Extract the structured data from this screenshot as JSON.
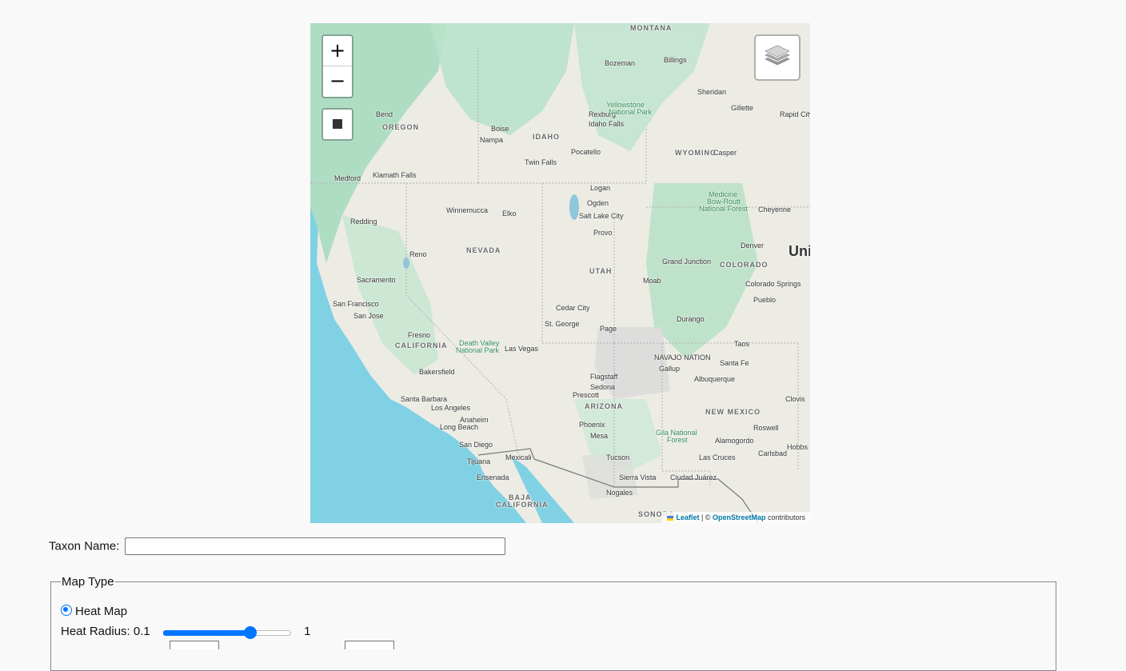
{
  "map": {
    "zoom_in_label": "+",
    "zoom_out_label": "−",
    "attribution": {
      "leaflet": "Leaflet",
      "separator": " | © ",
      "osm": "OpenStreetMap",
      "suffix": " contributors"
    },
    "labels": {
      "montana": "MONTANA",
      "idaho": "IDAHO",
      "oregon": "OREGON",
      "wyoming": "WYOMING",
      "nevada": "NEVADA",
      "utah": "UTAH",
      "colorado": "COLORADO",
      "california": "CALIFORNIA",
      "arizona": "ARIZONA",
      "new_mexico": "NEW MEXICO",
      "sonora": "SONORA",
      "baja1": "BAJA",
      "baja2": "CALIFORNIA",
      "uni": "Uni",
      "sacramento": "Sacramento",
      "san_francisco": "San Francisco",
      "san_jose": "San Jose",
      "fresno": "Fresno",
      "bakersfield": "Bakersfield",
      "los_angeles": "Los Angeles",
      "anaheim": "Anaheim",
      "long_beach": "Long Beach",
      "santa_barbara": "Santa Barbara",
      "san_diego": "San Diego",
      "tijuana": "Tijuana",
      "mexicali": "Mexicali",
      "ensenada": "Ensenada",
      "las_vegas": "Las Vegas",
      "reno": "Reno",
      "boise": "Boise",
      "nampa": "Nampa",
      "twin_falls": "Twin Falls",
      "pocatello": "Pocatello",
      "idaho_falls": "Idaho Falls",
      "rexburg": "Rexburg",
      "salt_lake_city": "Salt Lake City",
      "ogden": "Ogden",
      "provo": "Provo",
      "logan": "Logan",
      "st_george": "St. George",
      "cedar_city": "Cedar City",
      "denver": "Denver",
      "colorado_springs": "Colorado Springs",
      "pueblo": "Pueblo",
      "grand_junction": "Grand Junction",
      "cheyenne": "Cheyenne",
      "casper": "Casper",
      "billings": "Billings",
      "bozeman": "Bozeman",
      "phoenix": "Phoenix",
      "mesa": "Mesa",
      "tucson": "Tucson",
      "flagstaff": "Flagstaff",
      "prescott": "Prescott",
      "sedona": "Sedona",
      "albuquerque": "Albuquerque",
      "santa_fe": "Santa Fe",
      "las_cruces": "Las Cruces",
      "ciudad_juarez": "Ciudad Juárez",
      "nogales": "Nogales",
      "sierra_vista": "Sierra Vista",
      "bend": "Bend",
      "medford": "Medford",
      "klamath_falls": "Klamath Falls",
      "redding": "Redding",
      "winnemucca": "Winnemucca",
      "elko": "Elko",
      "death_valley1": "Death Valley",
      "death_valley2": "National Park",
      "navajo_nation": "NAVAJO NATION",
      "page": "Page",
      "durango": "Durango",
      "roswell": "Roswell",
      "hobbs": "Hobbs",
      "carlsbad": "Carlsbad",
      "alamogordo": "Alamogordo",
      "clovis": "Clovis",
      "gallup": "Gallup",
      "taos": "Taos",
      "moab": "Moab",
      "sheridan": "Sheridan",
      "gillette": "Gillette",
      "rapid_city": "Rapid City",
      "yellowstone1": "Yellowstone",
      "yellowstone2": "National Park",
      "medicine_bow1": "Medicine",
      "medicine_bow2": "Bow-Routt",
      "medicine_bow3": "National Forest",
      "gila1": "Gila National",
      "gila2": "Forest"
    }
  },
  "form": {
    "taxon_label": "Taxon Name:",
    "taxon_value": "",
    "map_type_legend": "Map Type",
    "heat_map_label": "Heat Map",
    "heat_map_selected": true,
    "heat_radius_label": "Heat Radius: 0.1",
    "heat_radius_max": "1",
    "heat_radius_fraction": 0.68
  }
}
